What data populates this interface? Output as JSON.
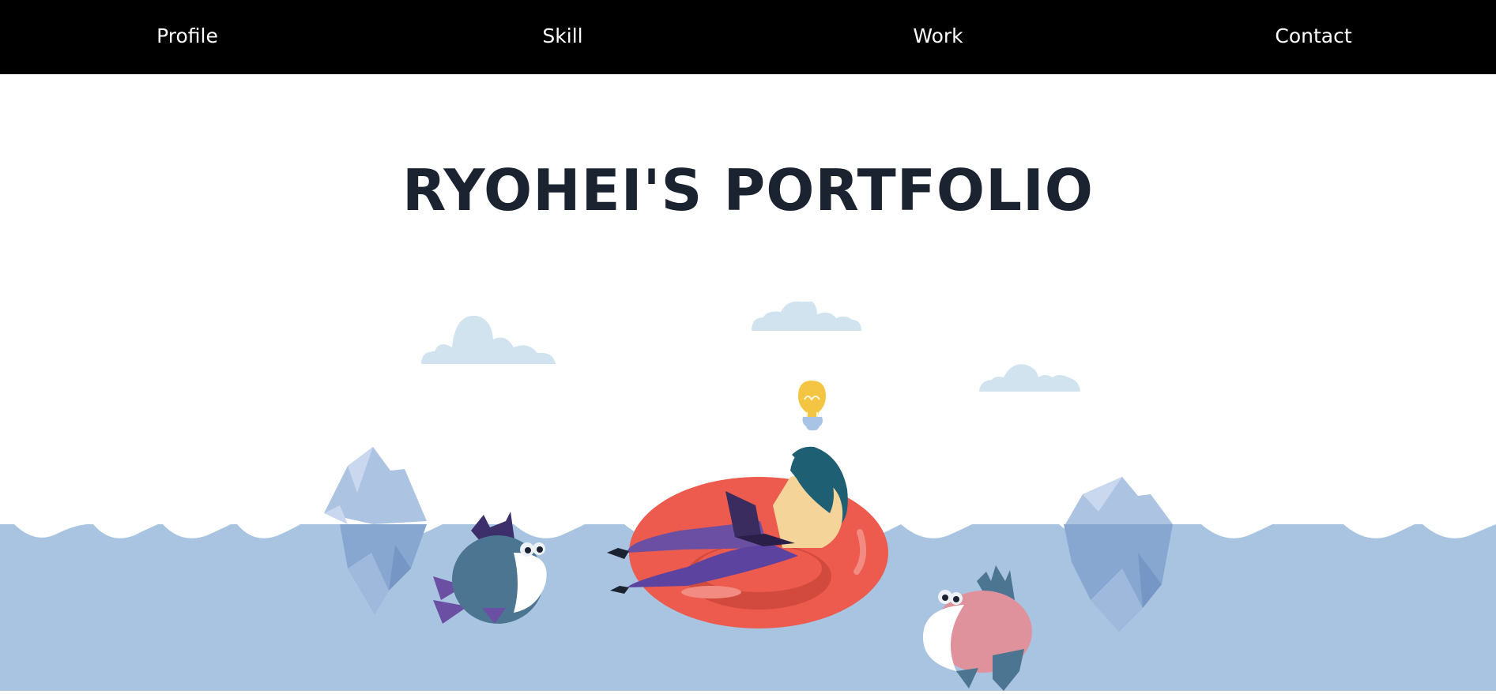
{
  "nav": {
    "items": [
      {
        "label": "Profile"
      },
      {
        "label": "Skill"
      },
      {
        "label": "Work"
      },
      {
        "label": "Contact"
      }
    ]
  },
  "hero": {
    "title": "RYOHEI'S PORTFOLIO"
  },
  "colors": {
    "nav_background": "#000000",
    "nav_text": "#ffffff",
    "title_text": "#1b2331",
    "sea": "#a8c4e0",
    "cloud": "#d2e3f0",
    "float_ring": "#ec5b4d",
    "bulb": "#f4c542"
  },
  "illustration": {
    "icons": [
      "cloud-icon",
      "light-bulb-icon",
      "iceberg-icon",
      "fish-icon",
      "swim-ring-icon",
      "laptop-icon"
    ]
  }
}
